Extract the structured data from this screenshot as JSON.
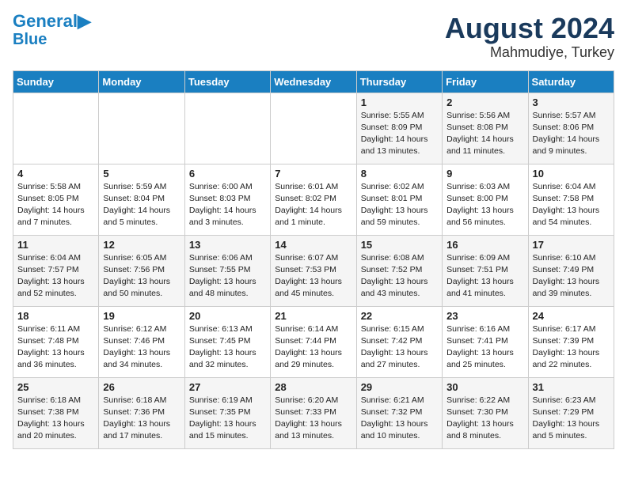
{
  "logo": {
    "line1": "General",
    "line2": "Blue"
  },
  "title": {
    "month": "August 2024",
    "location": "Mahmudiye, Turkey"
  },
  "headers": [
    "Sunday",
    "Monday",
    "Tuesday",
    "Wednesday",
    "Thursday",
    "Friday",
    "Saturday"
  ],
  "weeks": [
    [
      {
        "day": "",
        "info": ""
      },
      {
        "day": "",
        "info": ""
      },
      {
        "day": "",
        "info": ""
      },
      {
        "day": "",
        "info": ""
      },
      {
        "day": "1",
        "info": "Sunrise: 5:55 AM\nSunset: 8:09 PM\nDaylight: 14 hours\nand 13 minutes."
      },
      {
        "day": "2",
        "info": "Sunrise: 5:56 AM\nSunset: 8:08 PM\nDaylight: 14 hours\nand 11 minutes."
      },
      {
        "day": "3",
        "info": "Sunrise: 5:57 AM\nSunset: 8:06 PM\nDaylight: 14 hours\nand 9 minutes."
      }
    ],
    [
      {
        "day": "4",
        "info": "Sunrise: 5:58 AM\nSunset: 8:05 PM\nDaylight: 14 hours\nand 7 minutes."
      },
      {
        "day": "5",
        "info": "Sunrise: 5:59 AM\nSunset: 8:04 PM\nDaylight: 14 hours\nand 5 minutes."
      },
      {
        "day": "6",
        "info": "Sunrise: 6:00 AM\nSunset: 8:03 PM\nDaylight: 14 hours\nand 3 minutes."
      },
      {
        "day": "7",
        "info": "Sunrise: 6:01 AM\nSunset: 8:02 PM\nDaylight: 14 hours\nand 1 minute."
      },
      {
        "day": "8",
        "info": "Sunrise: 6:02 AM\nSunset: 8:01 PM\nDaylight: 13 hours\nand 59 minutes."
      },
      {
        "day": "9",
        "info": "Sunrise: 6:03 AM\nSunset: 8:00 PM\nDaylight: 13 hours\nand 56 minutes."
      },
      {
        "day": "10",
        "info": "Sunrise: 6:04 AM\nSunset: 7:58 PM\nDaylight: 13 hours\nand 54 minutes."
      }
    ],
    [
      {
        "day": "11",
        "info": "Sunrise: 6:04 AM\nSunset: 7:57 PM\nDaylight: 13 hours\nand 52 minutes."
      },
      {
        "day": "12",
        "info": "Sunrise: 6:05 AM\nSunset: 7:56 PM\nDaylight: 13 hours\nand 50 minutes."
      },
      {
        "day": "13",
        "info": "Sunrise: 6:06 AM\nSunset: 7:55 PM\nDaylight: 13 hours\nand 48 minutes."
      },
      {
        "day": "14",
        "info": "Sunrise: 6:07 AM\nSunset: 7:53 PM\nDaylight: 13 hours\nand 45 minutes."
      },
      {
        "day": "15",
        "info": "Sunrise: 6:08 AM\nSunset: 7:52 PM\nDaylight: 13 hours\nand 43 minutes."
      },
      {
        "day": "16",
        "info": "Sunrise: 6:09 AM\nSunset: 7:51 PM\nDaylight: 13 hours\nand 41 minutes."
      },
      {
        "day": "17",
        "info": "Sunrise: 6:10 AM\nSunset: 7:49 PM\nDaylight: 13 hours\nand 39 minutes."
      }
    ],
    [
      {
        "day": "18",
        "info": "Sunrise: 6:11 AM\nSunset: 7:48 PM\nDaylight: 13 hours\nand 36 minutes."
      },
      {
        "day": "19",
        "info": "Sunrise: 6:12 AM\nSunset: 7:46 PM\nDaylight: 13 hours\nand 34 minutes."
      },
      {
        "day": "20",
        "info": "Sunrise: 6:13 AM\nSunset: 7:45 PM\nDaylight: 13 hours\nand 32 minutes."
      },
      {
        "day": "21",
        "info": "Sunrise: 6:14 AM\nSunset: 7:44 PM\nDaylight: 13 hours\nand 29 minutes."
      },
      {
        "day": "22",
        "info": "Sunrise: 6:15 AM\nSunset: 7:42 PM\nDaylight: 13 hours\nand 27 minutes."
      },
      {
        "day": "23",
        "info": "Sunrise: 6:16 AM\nSunset: 7:41 PM\nDaylight: 13 hours\nand 25 minutes."
      },
      {
        "day": "24",
        "info": "Sunrise: 6:17 AM\nSunset: 7:39 PM\nDaylight: 13 hours\nand 22 minutes."
      }
    ],
    [
      {
        "day": "25",
        "info": "Sunrise: 6:18 AM\nSunset: 7:38 PM\nDaylight: 13 hours\nand 20 minutes."
      },
      {
        "day": "26",
        "info": "Sunrise: 6:18 AM\nSunset: 7:36 PM\nDaylight: 13 hours\nand 17 minutes."
      },
      {
        "day": "27",
        "info": "Sunrise: 6:19 AM\nSunset: 7:35 PM\nDaylight: 13 hours\nand 15 minutes."
      },
      {
        "day": "28",
        "info": "Sunrise: 6:20 AM\nSunset: 7:33 PM\nDaylight: 13 hours\nand 13 minutes."
      },
      {
        "day": "29",
        "info": "Sunrise: 6:21 AM\nSunset: 7:32 PM\nDaylight: 13 hours\nand 10 minutes."
      },
      {
        "day": "30",
        "info": "Sunrise: 6:22 AM\nSunset: 7:30 PM\nDaylight: 13 hours\nand 8 minutes."
      },
      {
        "day": "31",
        "info": "Sunrise: 6:23 AM\nSunset: 7:29 PM\nDaylight: 13 hours\nand 5 minutes."
      }
    ]
  ]
}
